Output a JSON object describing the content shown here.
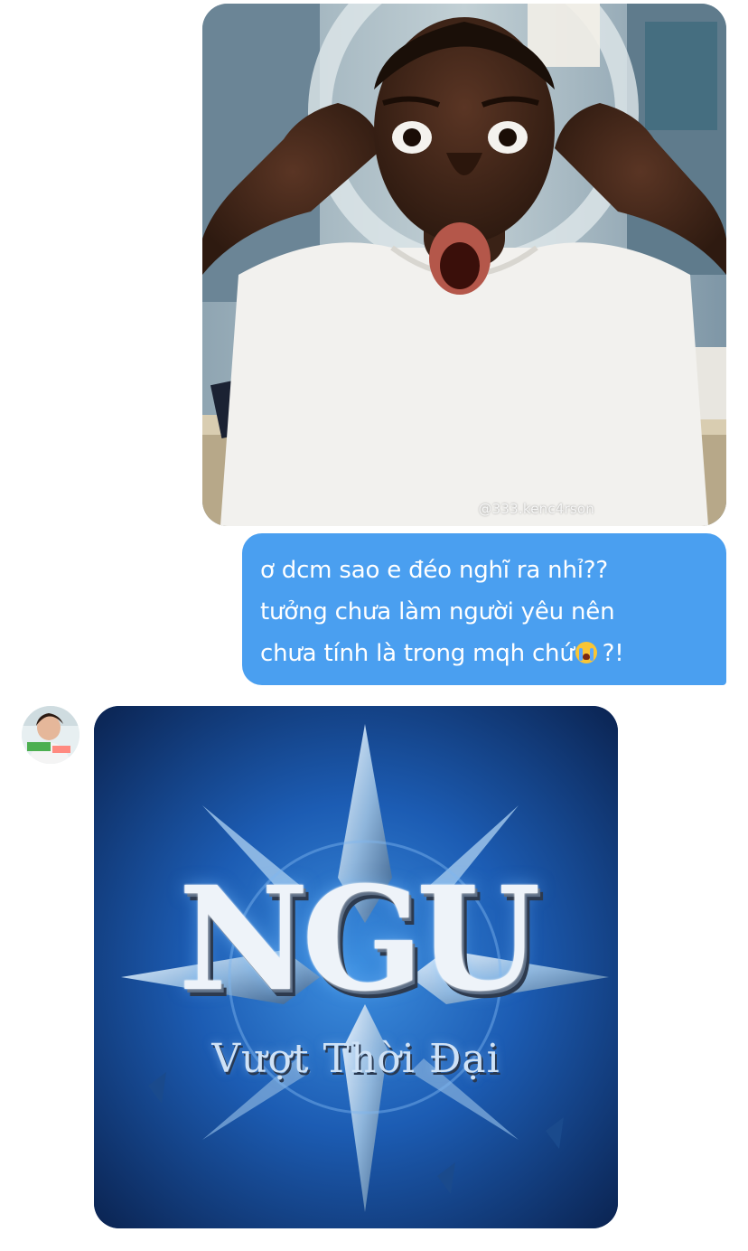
{
  "conversation": {
    "sent_image": {
      "kind": "photo",
      "watermark": "@333.kenc4rson"
    },
    "sent_message": {
      "lines": [
        "ơ dcm sao e đéo nghĩ ra nhỉ??",
        "tưởng chưa làm người yêu nên",
        "chưa tính là trong mqh chứ"
      ],
      "emoji": "loudly-crying-face-emoji",
      "trailing": "?!"
    },
    "received_image": {
      "logo_main": "NGU",
      "logo_sub": "Vượt Thời Đại"
    }
  },
  "colors": {
    "sent_bubble": "#4a9ff0",
    "sent_text": "#ffffff",
    "background": "#ffffff",
    "logo_bg": "#0e3470"
  },
  "icons": {
    "avatar": "contact-avatar",
    "emoji": "loudly-crying-face-emoji"
  }
}
